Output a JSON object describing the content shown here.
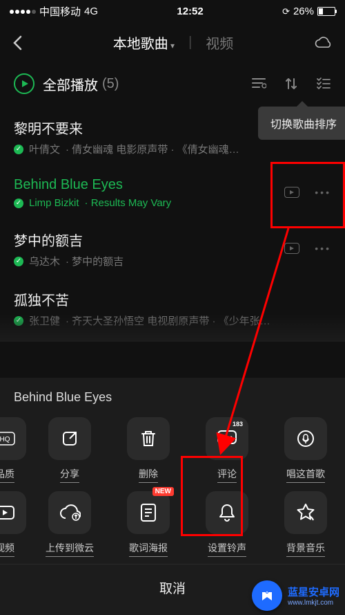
{
  "status": {
    "carrier": "中国移动",
    "network": "4G",
    "time": "12:52",
    "battery": "26%"
  },
  "header": {
    "tab_local": "本地歌曲",
    "tab_video": "视频"
  },
  "play_all": {
    "label": "全部播放",
    "count": "(5)"
  },
  "tooltip": "切换歌曲排序",
  "songs": [
    {
      "title": "黎明不要来",
      "artist": "叶倩文",
      "meta": "·  倩女幽魂 电影原声带  ·  《倩女幽魂…",
      "mv": false,
      "playing": false
    },
    {
      "title": "Behind Blue Eyes",
      "artist": "Limp Bizkit",
      "meta": "·  Results May Vary",
      "mv": true,
      "playing": true
    },
    {
      "title": "梦中的额吉",
      "artist": "乌达木",
      "meta": "·  梦中的额吉",
      "mv": true,
      "playing": false
    },
    {
      "title": "孤独不苦",
      "artist": "张卫健",
      "meta": "·  齐天大圣孙悟空 电视剧原声带  ·  《少年张…",
      "mv": false,
      "playing": false
    }
  ],
  "sheet": {
    "title": "Behind Blue Eyes",
    "row1": [
      {
        "key": "quality",
        "label": "品质",
        "partial": true
      },
      {
        "key": "share",
        "label": "分享"
      },
      {
        "key": "delete",
        "label": "删除"
      },
      {
        "key": "comment",
        "label": "评论",
        "badge": "183"
      },
      {
        "key": "sing",
        "label": "唱这首歌"
      }
    ],
    "row2": [
      {
        "key": "video",
        "label": "视频",
        "partial": true
      },
      {
        "key": "upload",
        "label": "上传到微云"
      },
      {
        "key": "poster",
        "label": "歌词海报",
        "badge": "NEW"
      },
      {
        "key": "ringtone",
        "label": "设置铃声"
      },
      {
        "key": "bgm",
        "label": "背景音乐"
      }
    ],
    "cancel": "取消"
  },
  "watermark": {
    "line1": "蓝星安卓网",
    "line2": "www.lmkjt.com"
  }
}
